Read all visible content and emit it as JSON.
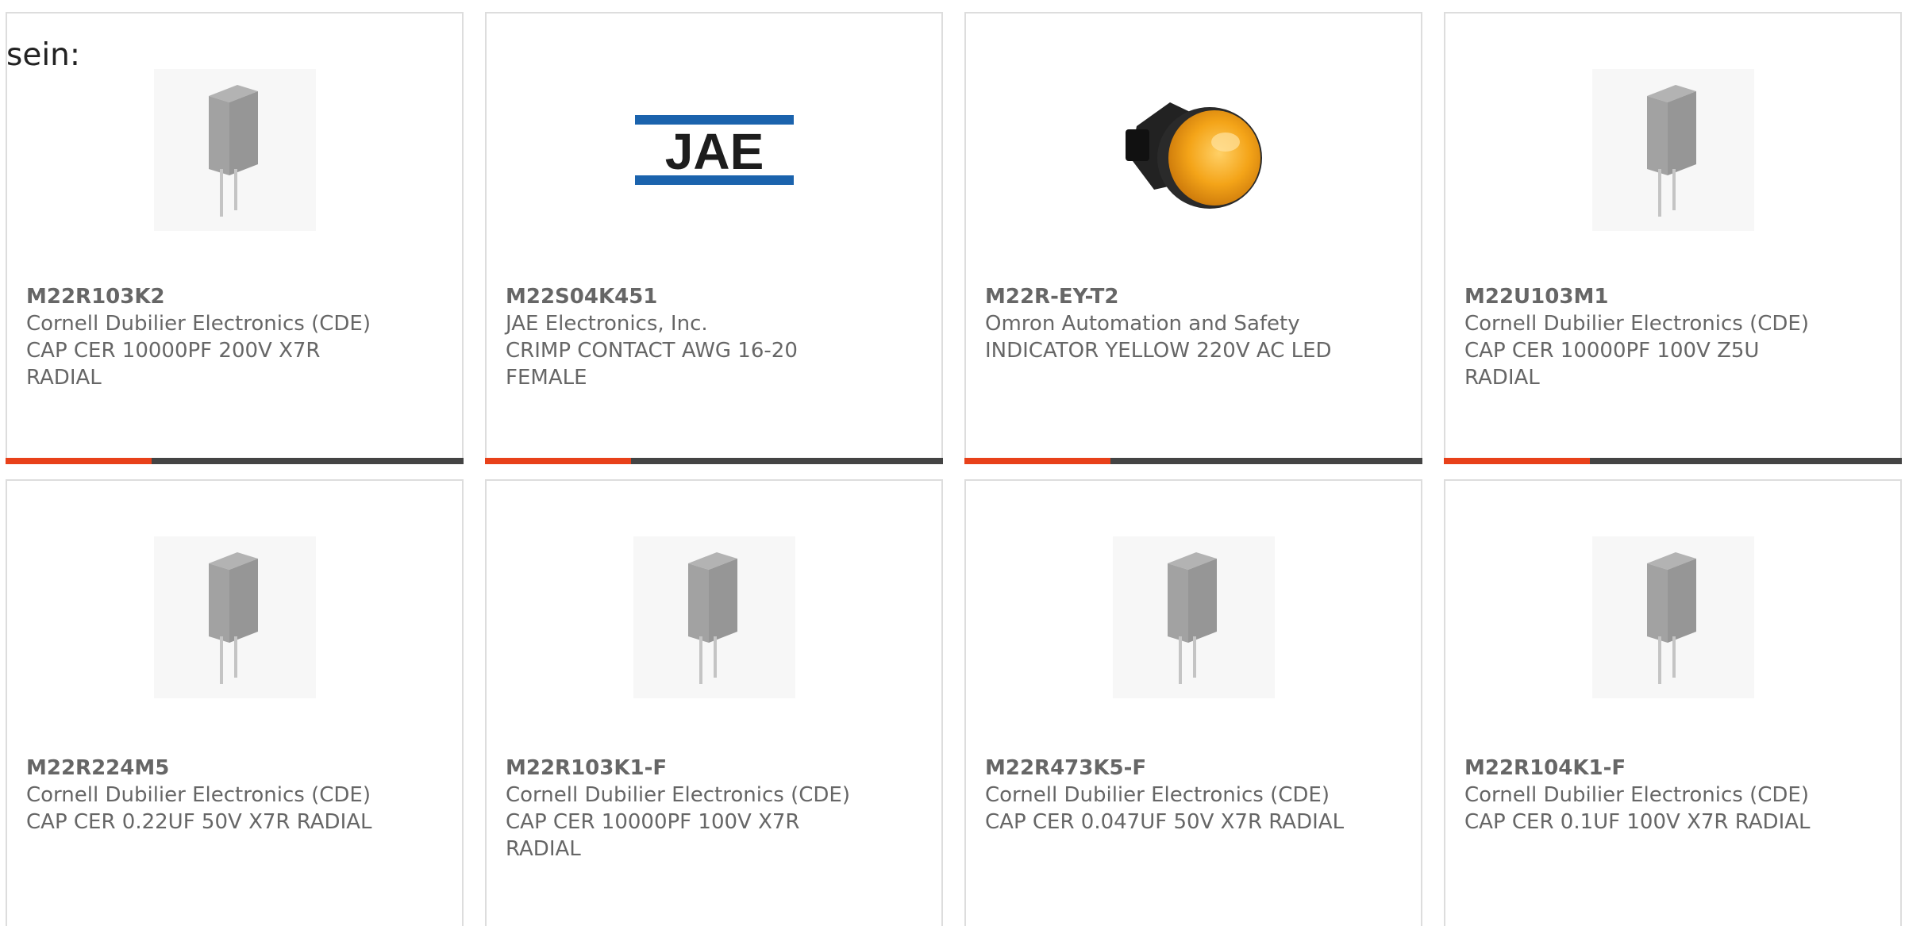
{
  "intro_text": "sein:",
  "accent_color": "#e8411a",
  "bar_color": "#444444",
  "products": [
    {
      "part_number": "M22R103K2",
      "manufacturer": "Cornell Dubilier Electronics (CDE)",
      "description": "CAP CER 10000PF 200V X7R RADIAL",
      "image_icon": "radial-capacitor-icon"
    },
    {
      "part_number": "M22S04K451",
      "manufacturer": "JAE Electronics, Inc.",
      "description": "CRIMP CONTACT AWG 16-20 FEMALE",
      "image_icon": "jae-logo",
      "logo_text": "JAE"
    },
    {
      "part_number": "M22R-EY-T2",
      "manufacturer": "Omron Automation and Safety",
      "description": "INDICATOR YELLOW 220V AC LED",
      "image_icon": "indicator-lamp-icon"
    },
    {
      "part_number": "M22U103M1",
      "manufacturer": "Cornell Dubilier Electronics (CDE)",
      "description": "CAP CER 10000PF 100V Z5U RADIAL",
      "image_icon": "radial-capacitor-icon"
    },
    {
      "part_number": "M22R224M5",
      "manufacturer": "Cornell Dubilier Electronics (CDE)",
      "description": "CAP CER 0.22UF 50V X7R RADIAL",
      "image_icon": "radial-capacitor-icon"
    },
    {
      "part_number": "M22R103K1-F",
      "manufacturer": "Cornell Dubilier Electronics (CDE)",
      "description": "CAP CER 10000PF 100V X7R RADIAL",
      "image_icon": "radial-capacitor-icon"
    },
    {
      "part_number": "M22R473K5-F",
      "manufacturer": "Cornell Dubilier Electronics (CDE)",
      "description": "CAP CER 0.047UF 50V X7R RADIAL",
      "image_icon": "radial-capacitor-icon"
    },
    {
      "part_number": "M22R104K1-F",
      "manufacturer": "Cornell Dubilier Electronics (CDE)",
      "description": "CAP CER 0.1UF 100V X7R RADIAL",
      "image_icon": "radial-capacitor-icon"
    }
  ]
}
